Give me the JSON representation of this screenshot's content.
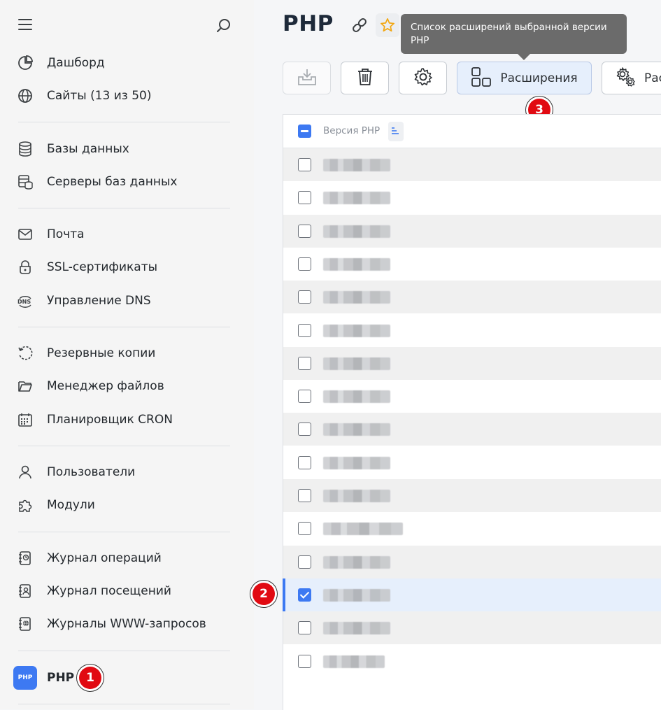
{
  "sidebar": {
    "items": [
      {
        "label": "Дашборд",
        "icon": "pie-chart-icon"
      },
      {
        "label": "Сайты (13 из 50)",
        "icon": "globe-icon"
      },
      {
        "label": "Базы данных",
        "icon": "database-icon"
      },
      {
        "label": "Серверы баз данных",
        "icon": "database-server-icon"
      },
      {
        "label": "Почта",
        "icon": "mail-icon"
      },
      {
        "label": "SSL-сертификаты",
        "icon": "lock-icon"
      },
      {
        "label": "Управление DNS",
        "icon": "dns-icon"
      },
      {
        "label": "Резервные копии",
        "icon": "backup-icon"
      },
      {
        "label": "Менеджер файлов",
        "icon": "folder-icon"
      },
      {
        "label": "Планировщик CRON",
        "icon": "calendar-icon"
      },
      {
        "label": "Пользователи",
        "icon": "user-icon"
      },
      {
        "label": "Модули",
        "icon": "puzzle-icon"
      },
      {
        "label": "Журнал операций",
        "icon": "operations-log-icon"
      },
      {
        "label": "Журнал посещений",
        "icon": "visits-log-icon"
      },
      {
        "label": "Журналы WWW-запросов",
        "icon": "www-log-icon"
      },
      {
        "label": "PHP",
        "icon": "php-logo"
      }
    ],
    "php_logo_text": "PHP"
  },
  "badges": {
    "b1": "1",
    "b2": "2",
    "b3": "3"
  },
  "header": {
    "title": "PHP",
    "tooltip": "Список расширений выбранной версии PHP"
  },
  "toolbar": {
    "extensions_label": "Расширения",
    "next_label": "Рас"
  },
  "table": {
    "column_header": "Версия PHP",
    "rows": [
      {
        "checked": false,
        "w": 96
      },
      {
        "checked": false,
        "w": 96
      },
      {
        "checked": false,
        "w": 96
      },
      {
        "checked": false,
        "w": 96
      },
      {
        "checked": false,
        "w": 96
      },
      {
        "checked": false,
        "w": 96
      },
      {
        "checked": false,
        "w": 96
      },
      {
        "checked": false,
        "w": 96
      },
      {
        "checked": false,
        "w": 96
      },
      {
        "checked": false,
        "w": 96
      },
      {
        "checked": false,
        "w": 96
      },
      {
        "checked": false,
        "w": 114
      },
      {
        "checked": false,
        "w": 96
      },
      {
        "checked": true,
        "w": 96
      },
      {
        "checked": false,
        "w": 96
      },
      {
        "checked": false,
        "w": 88
      }
    ]
  },
  "colors": {
    "accent": "#3d79f2",
    "badge": "#e10a12"
  }
}
